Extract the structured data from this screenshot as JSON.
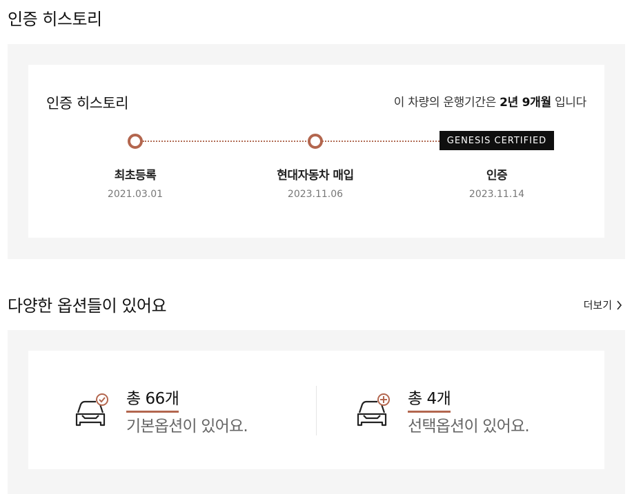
{
  "history_section": {
    "title": "인증 히스토리"
  },
  "history_card": {
    "title": "인증 히스토리",
    "period_prefix": "이 차량의 운행기간은",
    "period_value": "2년 9개월",
    "period_suffix": "입니다",
    "badge": "GENESIS CERTIFIED",
    "accent_color": "#b3664e",
    "steps": [
      {
        "label": "최초등록",
        "date": "2021.03.01"
      },
      {
        "label": "현대자동차 매입",
        "date": "2023.11.06"
      },
      {
        "label": "인증",
        "date": "2023.11.14"
      }
    ]
  },
  "options_section": {
    "title": "다양한 옵션들이 있어요",
    "more_label": "더보기"
  },
  "options": {
    "basic": {
      "count": "총 66개",
      "desc": "기본옵션이 있어요.",
      "icon": "car-check-icon"
    },
    "extra": {
      "count": "총 4개",
      "desc": "선택옵션이 있어요.",
      "icon": "car-plus-icon"
    }
  }
}
